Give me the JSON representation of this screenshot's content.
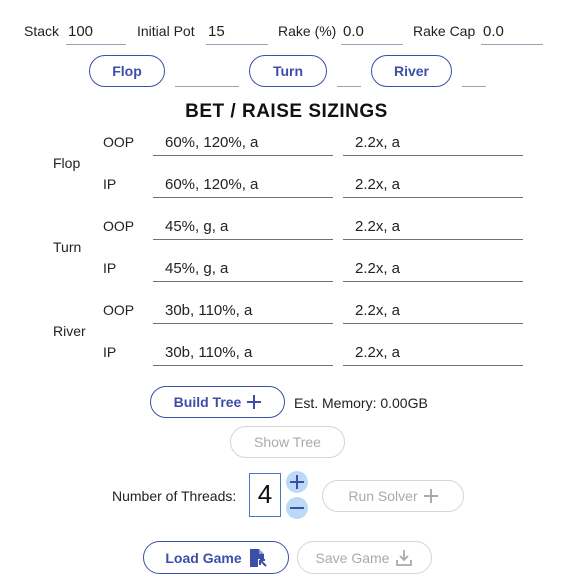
{
  "settings": {
    "stack_label": "Stack",
    "stack_value": "100",
    "pot_label": "Initial Pot",
    "pot_value": "15",
    "rake_label": "Rake (%)",
    "rake_value": "0.0",
    "rakecap_label": "Rake Cap",
    "rakecap_value": "0.0"
  },
  "streets": {
    "flop_button": "Flop",
    "flop_value": "",
    "turn_button": "Turn",
    "turn_value": "",
    "river_button": "River",
    "river_value": ""
  },
  "sizings": {
    "title": "BET / RAISE SIZINGS",
    "groups": [
      {
        "street": "Flop",
        "rows": [
          {
            "pos": "OOP",
            "bet": "60%, 120%, a",
            "raise": "2.2x, a"
          },
          {
            "pos": "IP",
            "bet": "60%, 120%, a",
            "raise": "2.2x, a"
          }
        ]
      },
      {
        "street": "Turn",
        "rows": [
          {
            "pos": "OOP",
            "bet": "45%, g, a",
            "raise": "2.2x, a"
          },
          {
            "pos": "IP",
            "bet": "45%, g, a",
            "raise": "2.2x, a"
          }
        ]
      },
      {
        "street": "River",
        "rows": [
          {
            "pos": "OOP",
            "bet": "30b, 110%, a",
            "raise": "2.2x, a"
          },
          {
            "pos": "IP",
            "bet": "30b, 110%, a",
            "raise": "2.2x, a"
          }
        ]
      }
    ]
  },
  "actions": {
    "build_tree": "Build Tree",
    "memory": "Est. Memory: 0.00GB",
    "show_tree": "Show Tree",
    "threads_label": "Number of Threads:",
    "threads_value": "4",
    "run_solver": "Run Solver",
    "load_game": "Load Game",
    "save_game": "Save Game"
  },
  "colors": {
    "accent": "#3b4fa8",
    "disabled": "#aaaaaa",
    "stepper": "#bcd9f7"
  },
  "icons": {
    "build_tree": "plus-icon",
    "run_solver": "plus-icon",
    "load_game": "file-import-icon",
    "save_game": "download-icon",
    "thread_inc": "plus-icon",
    "thread_dec": "minus-icon"
  }
}
